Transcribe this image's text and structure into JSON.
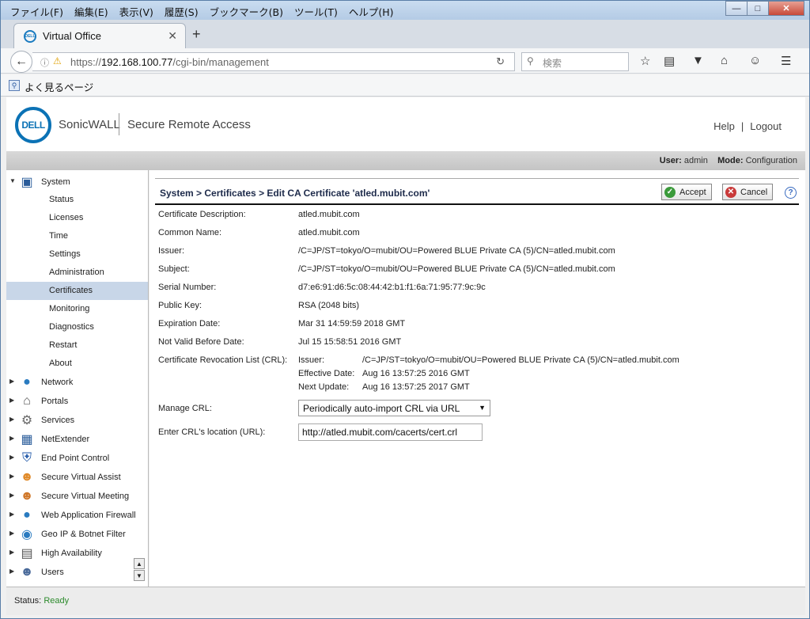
{
  "browser": {
    "menu": [
      "ファイル(F)",
      "編集(E)",
      "表示(V)",
      "履歴(S)",
      "ブックマーク(B)",
      "ツール(T)",
      "ヘルプ(H)"
    ],
    "tab_title": "Virtual Office",
    "favicon_text": "DELL",
    "url_prefix": "https://",
    "url_host": "192.168.100.77",
    "url_path": "/cgi-bin/management",
    "search_placeholder": "検索",
    "bookmark_label": "よく見るページ"
  },
  "header": {
    "logo": "DELL",
    "brand": "SonicWALL",
    "product": "Secure Remote Access",
    "help": "Help",
    "sep": "|",
    "logout": "Logout",
    "user_label": "User:",
    "user_value": "admin",
    "mode_label": "Mode:",
    "mode_value": "Configuration"
  },
  "sidebar": {
    "system": "System",
    "system_items": [
      "Status",
      "Licenses",
      "Time",
      "Settings",
      "Administration",
      "Certificates",
      "Monitoring",
      "Diagnostics",
      "Restart",
      "About"
    ],
    "active_item": "Certificates",
    "groups": [
      "Network",
      "Portals",
      "Services",
      "NetExtender",
      "End Point Control",
      "Secure Virtual Assist",
      "Secure Virtual Meeting",
      "Web Application Firewall",
      "Geo IP & Botnet Filter",
      "High Availability",
      "Users"
    ]
  },
  "page": {
    "title": "System > Certificates > Edit CA Certificate 'atled.mubit.com'",
    "accept": "Accept",
    "cancel": "Cancel",
    "fields": [
      {
        "label": "Certificate Description:",
        "value": "atled.mubit.com"
      },
      {
        "label": "Common Name:",
        "value": "atled.mubit.com"
      },
      {
        "label": "Issuer:",
        "value": "/C=JP/ST=tokyo/O=mubit/OU=Powered BLUE Private CA (5)/CN=atled.mubit.com"
      },
      {
        "label": "Subject:",
        "value": "/C=JP/ST=tokyo/O=mubit/OU=Powered BLUE Private CA (5)/CN=atled.mubit.com"
      },
      {
        "label": "Serial Number:",
        "value": "d7:e6:91:d6:5c:08:44:42:b1:f1:6a:71:95:77:9c:9c"
      },
      {
        "label": "Public Key:",
        "value": "RSA (2048 bits)"
      },
      {
        "label": "Expiration Date:",
        "value": "Mar 31 14:59:59 2018 GMT"
      },
      {
        "label": "Not Valid Before Date:",
        "value": "Jul 15 15:58:51 2016 GMT"
      }
    ],
    "crl_label": "Certificate Revocation List (CRL):",
    "crl": [
      {
        "key": "Issuer:",
        "value": "/C=JP/ST=tokyo/O=mubit/OU=Powered BLUE Private CA (5)/CN=atled.mubit.com"
      },
      {
        "key": "Effective Date:",
        "value": "Aug 16 13:57:25 2016 GMT"
      },
      {
        "key": "Next Update:",
        "value": "Aug 16 13:57:25 2017 GMT"
      }
    ],
    "manage_crl_label": "Manage CRL:",
    "manage_crl_value": "Periodically auto-import CRL via URL",
    "crl_url_label": "Enter CRL's location (URL):",
    "crl_url_value": "http://atled.mubit.com/cacerts/cert.crl"
  },
  "status": {
    "label": "Status:",
    "value": "Ready"
  },
  "colors": {
    "accent": "#0b72b5",
    "active_row": "#c8d6e8",
    "status_ok": "#2b8a2b"
  }
}
